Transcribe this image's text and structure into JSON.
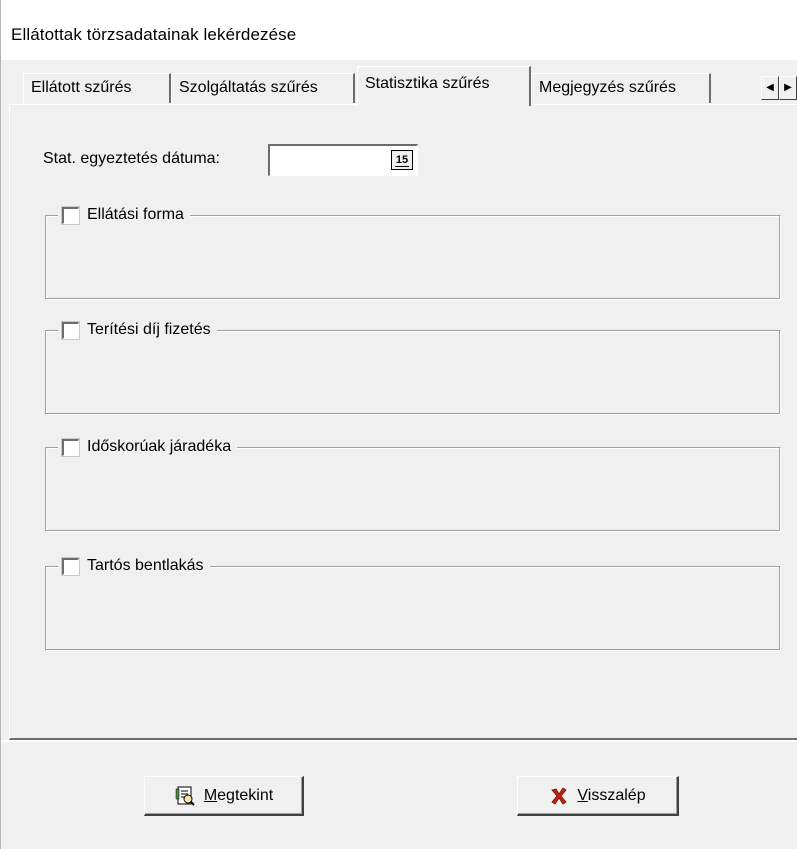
{
  "window": {
    "title": "Ellátottak törzsadatainak lekérdezése"
  },
  "tabs": [
    {
      "label": "Ellátott szűrés",
      "active": false
    },
    {
      "label": "Szolgáltatás szűrés",
      "active": false
    },
    {
      "label": "Statisztika szűrés",
      "active": true
    },
    {
      "label": "Megjegyzés szűrés",
      "active": false
    }
  ],
  "tab_scroll": {
    "left_icon": "triangle-left",
    "right_icon": "triangle-right"
  },
  "date_filter": {
    "label": "Stat. egyeztetés dátuma:",
    "value": "",
    "calendar_icon_text": "15"
  },
  "groups": [
    {
      "label": "Ellátási forma",
      "checked": false
    },
    {
      "label": "Terítési díj fizetés",
      "checked": false
    },
    {
      "label": "Időskorúak járadéka",
      "checked": false
    },
    {
      "label": "Tartós bentlakás",
      "checked": false
    }
  ],
  "buttons": {
    "view": {
      "first_letter": "M",
      "rest": "egtekint",
      "icon": "view-report-icon"
    },
    "back": {
      "first_letter": "V",
      "rest": "isszalép",
      "icon": "red-x-icon",
      "icon_color": "#c8200a"
    }
  }
}
